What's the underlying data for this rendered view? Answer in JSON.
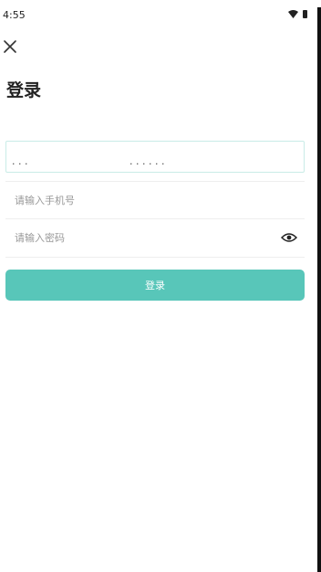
{
  "status_bar": {
    "time": "4:55",
    "icons": [
      "wifi-icon",
      "battery-icon"
    ]
  },
  "header": {
    "close_icon": "close-icon",
    "title": "登录"
  },
  "login_tabs": {
    "border_color": "#c9ece7"
  },
  "form": {
    "phone": {
      "placeholder": "请输入手机号",
      "value": ""
    },
    "password": {
      "placeholder": "请输入密码",
      "value": "",
      "visibility_icon": "eye-icon"
    },
    "submit_label": "登录"
  },
  "colors": {
    "accent": "#58c6b9",
    "divider": "#eeeeee",
    "placeholder": "#999999"
  }
}
